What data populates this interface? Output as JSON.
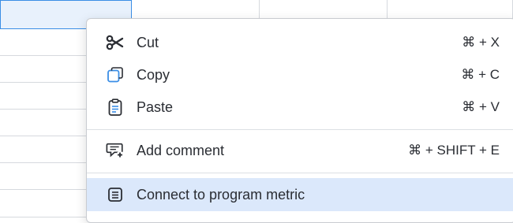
{
  "menu": {
    "items": [
      {
        "icon": "scissors-icon",
        "label": "Cut",
        "shortcut": "⌘ + X"
      },
      {
        "icon": "copy-icon",
        "label": "Copy",
        "shortcut": "⌘ + C"
      },
      {
        "icon": "clipboard-icon",
        "label": "Paste",
        "shortcut": "⌘ + V"
      },
      {
        "icon": "add-comment-icon",
        "label": "Add comment",
        "shortcut": "⌘ + SHIFT + E"
      },
      {
        "icon": "document-icon",
        "label": "Connect to program metric",
        "shortcut": ""
      }
    ]
  },
  "colors": {
    "accent": "#3a8ee6",
    "highlight": "#dbe8fb"
  }
}
